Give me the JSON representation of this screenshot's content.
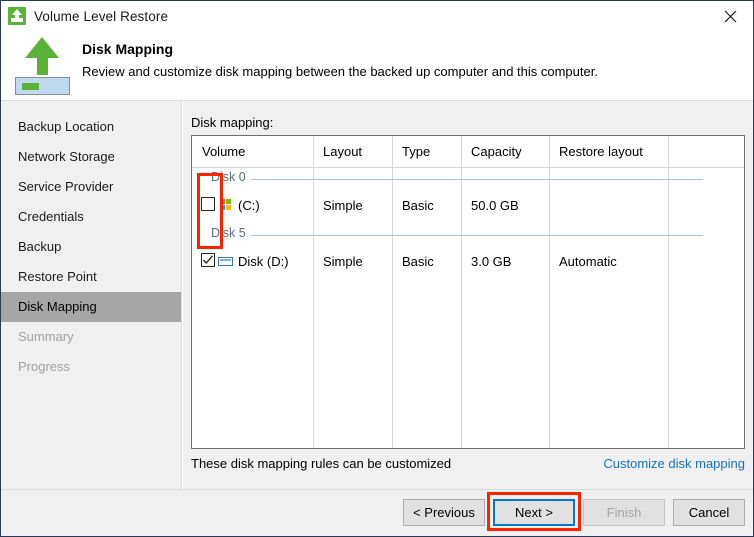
{
  "window": {
    "title": "Volume Level Restore",
    "title_icon": "upload-volume-icon",
    "close_icon": "close-icon"
  },
  "header": {
    "icon": "green-up-arrow-restore-icon",
    "title": "Disk Mapping",
    "subtitle": "Review and customize disk mapping between the backed up computer and this computer."
  },
  "sidebar": {
    "items": [
      {
        "label": "Backup Location",
        "state": "normal"
      },
      {
        "label": "Network Storage",
        "state": "normal"
      },
      {
        "label": "Service Provider",
        "state": "normal"
      },
      {
        "label": "Credentials",
        "state": "normal"
      },
      {
        "label": "Backup",
        "state": "normal"
      },
      {
        "label": "Restore Point",
        "state": "normal"
      },
      {
        "label": "Disk Mapping",
        "state": "selected"
      },
      {
        "label": "Summary",
        "state": "disabled"
      },
      {
        "label": "Progress",
        "state": "disabled"
      }
    ]
  },
  "main": {
    "section_label": "Disk mapping:",
    "columns": [
      "Volume",
      "Layout",
      "Type",
      "Capacity",
      "Restore layout"
    ],
    "groups": [
      {
        "name": "Disk 0",
        "rows": [
          {
            "checked": false,
            "icon": "windows-logo-icon",
            "volume": "(C:)",
            "layout": "Simple",
            "type": "Basic",
            "capacity": "50.0 GB",
            "restore_layout": ""
          }
        ]
      },
      {
        "name": "Disk 5",
        "rows": [
          {
            "checked": true,
            "icon": "disk-drive-icon",
            "volume": "Disk (D:)",
            "layout": "Simple",
            "type": "Basic",
            "capacity": "3.0 GB",
            "restore_layout": "Automatic"
          }
        ]
      }
    ],
    "note_text": "These disk mapping rules can be customized",
    "note_link": "Customize disk mapping"
  },
  "footer": {
    "previous": "< Previous",
    "next": "Next >",
    "finish": "Finish",
    "cancel": "Cancel"
  },
  "colors": {
    "accent_green": "#5cb239",
    "link_blue": "#1a6fc4",
    "focus_blue": "#0078d7",
    "annotation_red": "#ff2200",
    "selected_gray": "#a6a6a6"
  }
}
